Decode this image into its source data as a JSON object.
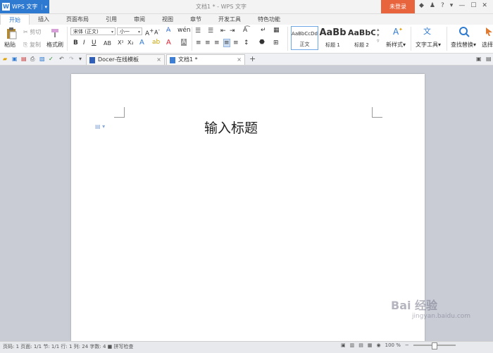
{
  "titlebar": {
    "app_name": "WPS 文字",
    "window_title": "文档1 * - WPS 文字",
    "login_label": "未登录",
    "help_label": "?"
  },
  "menu_tabs": [
    "开始",
    "插入",
    "页面布局",
    "引用",
    "审阅",
    "视图",
    "章节",
    "开发工具",
    "特色功能"
  ],
  "ribbon": {
    "clipboard": {
      "paste": "粘贴",
      "cut": "剪切",
      "copy": "复制",
      "format_painter": "格式刷"
    },
    "font": {
      "font_name": "宋体 (正文)",
      "font_size": "小一"
    },
    "styles": [
      {
        "sample": "AaBbCcDd",
        "label": "正文"
      },
      {
        "sample": "AaBb",
        "label": "标题 1"
      },
      {
        "sample": "AaBbC",
        "label": "标题 2"
      }
    ],
    "new_style": "新样式",
    "text_tools": "文字工具",
    "find_replace": "查找替换",
    "select": "选择"
  },
  "doc_tabs": [
    {
      "label": "Docer-在线模板"
    },
    {
      "label": "文档1 *"
    }
  ],
  "document": {
    "heading": "输入标题"
  },
  "statusbar": {
    "left": "页码: 1  页面: 1/1  节: 1/1  行: 1  列: 24  字数: 4  ■ 拼写检查",
    "zoom": "100 %"
  },
  "watermark": {
    "brand": "Bai 经验",
    "url": "jingyan.baidu.com"
  },
  "colors": {
    "accent": "#2f7ad1",
    "login": "#e8643c",
    "canvas": "#c9ccd4"
  }
}
